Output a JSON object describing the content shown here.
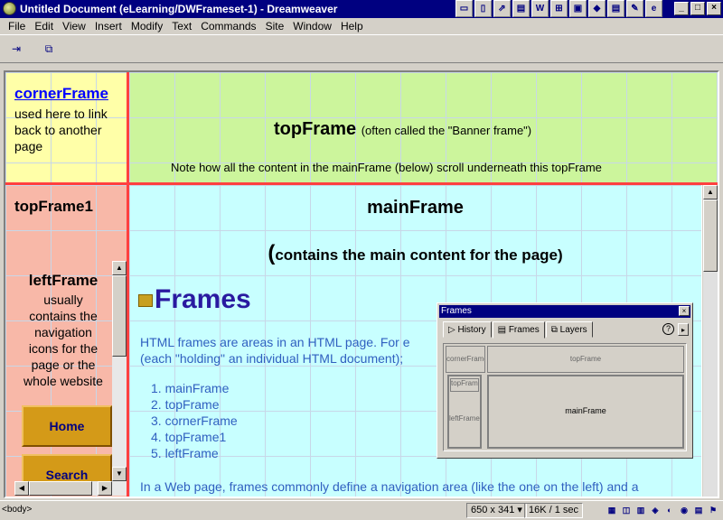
{
  "window": {
    "title": "Untitled Document (eLearning/DWFrameset-1) - Dreamweaver",
    "buttons": {
      "minimize": "_",
      "maximize": "□",
      "close": "×"
    }
  },
  "launcher": [
    "▭",
    "▯",
    "⇗",
    "▤",
    "W",
    "⊞",
    "▣",
    "◆",
    "▤",
    "✎",
    "e"
  ],
  "menu": [
    "File",
    "Edit",
    "View",
    "Insert",
    "Modify",
    "Text",
    "Commands",
    "Site",
    "Window",
    "Help"
  ],
  "toolbar": {
    "icon1": "⇥",
    "icon2": "⧉"
  },
  "corner_frame": {
    "link": "cornerFrame",
    "lines": [
      "used here to link",
      "back to another",
      "page"
    ]
  },
  "top_frame": {
    "heading": "topFrame",
    "heading_note": "(often called the \"Banner frame\")",
    "note": "Note how all the content in the mainFrame (below) scroll underneath this topFrame"
  },
  "top_frame1": {
    "heading": "topFrame1"
  },
  "left_frame": {
    "heading": "leftFrame",
    "lines": [
      "usually",
      "contains the",
      "navigation",
      "icons for the",
      "page or the",
      "whole website"
    ],
    "nav_home": "Home",
    "nav_second": "Search"
  },
  "main_frame": {
    "heading": "mainFrame",
    "sub_open": "(",
    "sub_text": "contains the main content for the page)",
    "section_title": "Frames",
    "para_line1": "HTML frames are areas in an HTML page. For e",
    "para_line2": "(each \"holding\" an individual HTML document);",
    "list": [
      "1.  mainFrame",
      "2.  topFrame",
      "3.  cornerFrame",
      "4.  topFrame1",
      "5.  leftFrame"
    ],
    "bottom_line": "In a Web page, frames commonly define a navigation area (like the one on the left) and a"
  },
  "frames_panel": {
    "title": "Frames",
    "close": "×",
    "tabs": [
      "History",
      "Frames",
      "Layers"
    ],
    "help": "?",
    "arrow": "▸",
    "map": {
      "corner": "cornerFrame",
      "top": "topFrame",
      "top1": "topFrame1",
      "left": "leftFrame",
      "main": "mainFrame"
    }
  },
  "status": {
    "tag": "<body>",
    "size": "650 x 341 ▾",
    "download": "16K / 1 sec"
  },
  "status_icons": [
    "▦",
    "◫",
    "▥",
    "◈",
    "◐",
    "◉",
    "▤",
    "⚑",
    "◆",
    "⊟"
  ]
}
